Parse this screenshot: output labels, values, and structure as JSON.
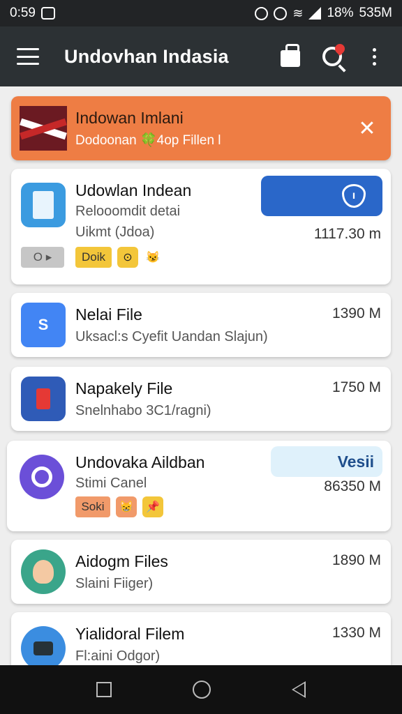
{
  "status_bar": {
    "time": "0:59",
    "battery_percent": "18%",
    "right_text": "535M"
  },
  "app_bar": {
    "title": "Undovhan Indasia",
    "icons": [
      "menu-icon",
      "bag-icon",
      "search-pin-icon",
      "more-icon"
    ]
  },
  "banner": {
    "title": "Indowan Imlani",
    "subtitle": "Dodoonan 🍀4op Fillen l",
    "close_glyph": "✕"
  },
  "items": [
    {
      "name": "Udowlan Indean",
      "sub1": "Relooomdit detai",
      "sub2": "Uikmt (Jdoa)",
      "size": "1117.30 m",
      "chips": {
        "toggle": "O ▸",
        "tag": "Doik",
        "coin": "⊙",
        "emoji": "😼"
      }
    },
    {
      "name": "Nelai File",
      "sub1": "Uksacl:s Cyefit Uandan Slajun)",
      "size": "1390 M"
    },
    {
      "name": "Napakely File",
      "sub1": "Snelnhabo 3C1/ragni)",
      "size": "1750 M"
    },
    {
      "name": "Undovaka Aildban",
      "sub1": "Stimi Canel",
      "size": "86350 M",
      "view_label": "Vesii",
      "chips": {
        "tag": "Soki",
        "emoji": "😸",
        "pin": "📌"
      }
    },
    {
      "name": "Aidogm Files",
      "sub1": "Slaini Fiiger)",
      "size": "1890 M"
    },
    {
      "name": "Yialidoral Filem",
      "sub1": "Fl:aini Odgor)",
      "size": "1330 M"
    }
  ],
  "colors": {
    "app_bar": "#2c3134",
    "banner": "#ee7d44",
    "action_button": "#2a67c9",
    "view_button_bg": "#dff1fb"
  }
}
